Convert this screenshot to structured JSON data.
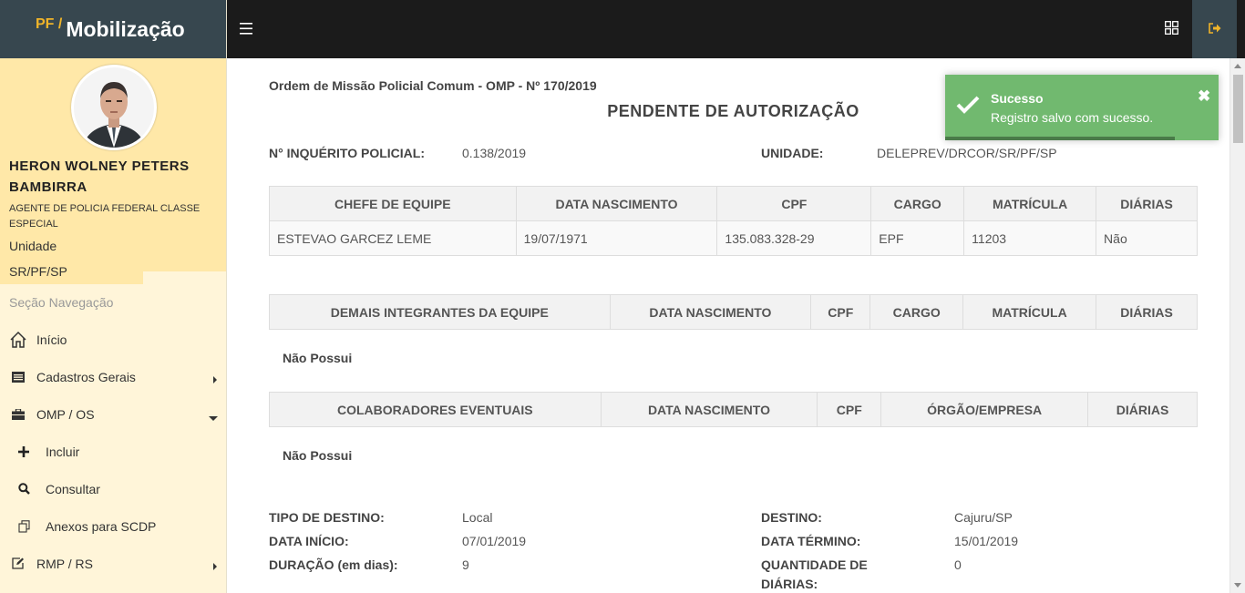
{
  "brand": {
    "prefix": "PF /",
    "title": "Mobilização"
  },
  "user": {
    "name": "HERON WOLNEY PETERS BAMBIRRA",
    "role": "AGENTE DE POLICIA FEDERAL CLASSE ESPECIAL",
    "unit_label": "Unidade",
    "unit_value": "SR/PF/SP"
  },
  "nav": {
    "section": "Seção Navegação",
    "items": [
      {
        "label": "Início",
        "icon": "home-icon"
      },
      {
        "label": "Cadastros Gerais",
        "icon": "list-icon"
      },
      {
        "label": "OMP / OS",
        "icon": "briefcase-icon"
      },
      {
        "label": "Incluir",
        "icon": "plus-icon"
      },
      {
        "label": "Consultar",
        "icon": "search-icon"
      },
      {
        "label": "Anexos para SCDP",
        "icon": "copy-icon"
      },
      {
        "label": "RMP / RS",
        "icon": "edit-icon"
      }
    ]
  },
  "doc": {
    "title": "Ordem de Missão Policial Comum - OMP - Nº 170/2019",
    "status": "PENDENTE DE AUTORIZAÇÃO",
    "inquerito_label": "N° INQUÉRITO POLICIAL:",
    "inquerito_value": "0.138/2019",
    "unidade_label": "UNIDADE:",
    "unidade_value": "DELEPREV/DRCOR/SR/PF/SP"
  },
  "chefe_table": {
    "headers": [
      "CHEFE DE EQUIPE",
      "DATA NASCIMENTO",
      "CPF",
      "CARGO",
      "MATRÍCULA",
      "DIÁRIAS"
    ],
    "row": [
      "ESTEVAO GARCEZ LEME",
      "19/07/1971",
      "135.083.328-29",
      "EPF",
      "11203",
      "Não"
    ]
  },
  "demais_table": {
    "headers": [
      "DEMAIS INTEGRANTES DA EQUIPE",
      "DATA NASCIMENTO",
      "CPF",
      "CARGO",
      "MATRÍCULA",
      "DIÁRIAS"
    ],
    "empty": "Não Possui"
  },
  "colab_table": {
    "headers": [
      "COLABORADORES EVENTUAIS",
      "DATA NASCIMENTO",
      "CPF",
      "ÓRGÃO/EMPRESA",
      "DIÁRIAS"
    ],
    "empty": "Não Possui"
  },
  "details": {
    "tipo_label": "TIPO DE DESTINO:",
    "tipo_value": "Local",
    "destino_label": "DESTINO:",
    "destino_value": "Cajuru/SP",
    "inicio_label": "DATA INÍCIO:",
    "inicio_value": "07/01/2019",
    "termino_label": "DATA TÉRMINO:",
    "termino_value": "15/01/2019",
    "duracao_label": "DURAÇÃO (em dias):",
    "duracao_value": "9",
    "qtd_label_1": "QUANTIDADE DE",
    "qtd_label_2": "DIÁRIAS:",
    "qtd_value": "0"
  },
  "toast": {
    "title": "Sucesso",
    "message": "Registro salvo com sucesso.",
    "close": "✖",
    "color": "#71b96f"
  }
}
